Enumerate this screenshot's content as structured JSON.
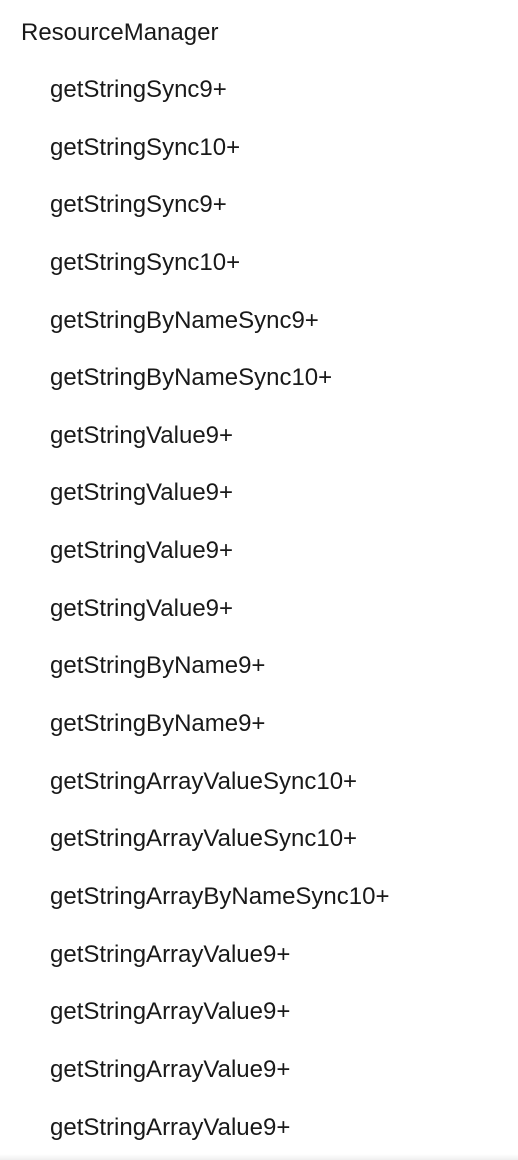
{
  "section": {
    "title": "ResourceManager"
  },
  "items": [
    {
      "label": "getStringSync9+"
    },
    {
      "label": "getStringSync10+"
    },
    {
      "label": "getStringSync9+"
    },
    {
      "label": "getStringSync10+"
    },
    {
      "label": "getStringByNameSync9+"
    },
    {
      "label": "getStringByNameSync10+"
    },
    {
      "label": "getStringValue9+"
    },
    {
      "label": "getStringValue9+"
    },
    {
      "label": "getStringValue9+"
    },
    {
      "label": "getStringValue9+"
    },
    {
      "label": "getStringByName9+"
    },
    {
      "label": "getStringByName9+"
    },
    {
      "label": "getStringArrayValueSync10+"
    },
    {
      "label": "getStringArrayValueSync10+"
    },
    {
      "label": "getStringArrayByNameSync10+"
    },
    {
      "label": "getStringArrayValue9+"
    },
    {
      "label": "getStringArrayValue9+"
    },
    {
      "label": "getStringArrayValue9+"
    },
    {
      "label": "getStringArrayValue9+"
    }
  ]
}
